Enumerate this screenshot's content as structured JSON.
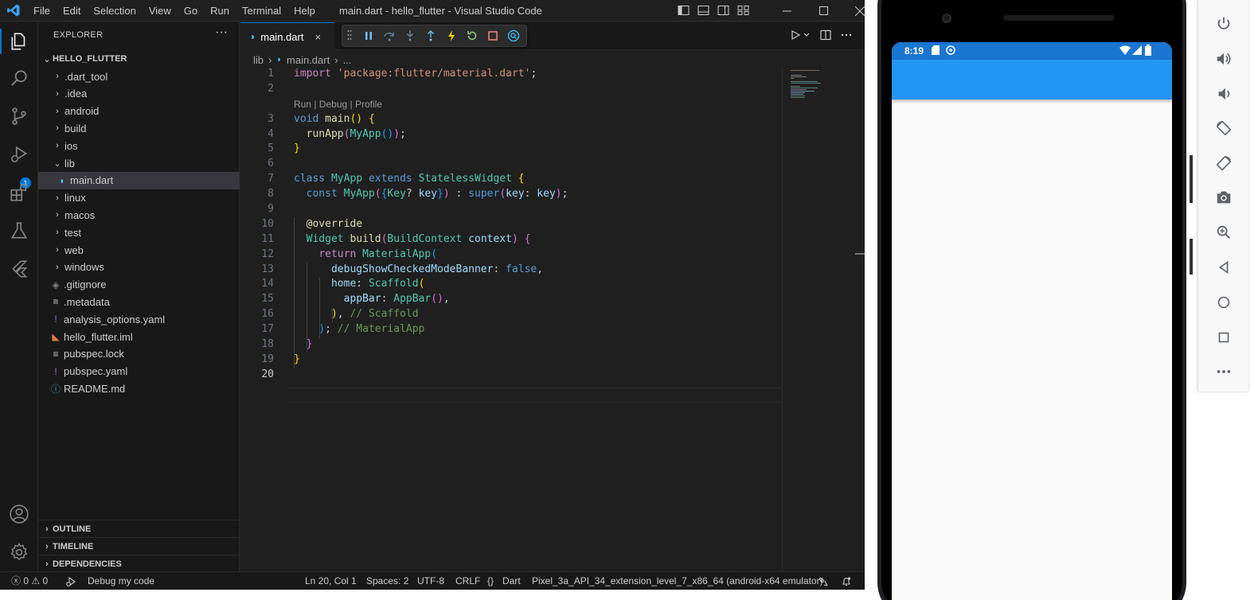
{
  "titlebar": {
    "menu": [
      "File",
      "Edit",
      "Selection",
      "View",
      "Go",
      "Run",
      "Terminal",
      "Help"
    ],
    "title": "main.dart - hello_flutter - Visual Studio Code"
  },
  "activitybar": {
    "debug_badge": "1"
  },
  "sidebar": {
    "header": "EXPLORER",
    "more": "···",
    "project": "HELLO_FLUTTER",
    "items": [
      {
        "label": ".dart_tool",
        "type": "folder"
      },
      {
        "label": ".idea",
        "type": "folder"
      },
      {
        "label": "android",
        "type": "folder"
      },
      {
        "label": "build",
        "type": "folder"
      },
      {
        "label": "ios",
        "type": "folder"
      },
      {
        "label": "lib",
        "type": "folder-open"
      },
      {
        "label": "main.dart",
        "type": "dart-file"
      },
      {
        "label": "linux",
        "type": "folder"
      },
      {
        "label": "macos",
        "type": "folder"
      },
      {
        "label": "test",
        "type": "folder"
      },
      {
        "label": "web",
        "type": "folder"
      },
      {
        "label": "windows",
        "type": "folder"
      },
      {
        "label": ".gitignore",
        "type": "git-file"
      },
      {
        "label": ".metadata",
        "type": "lines-file"
      },
      {
        "label": "analysis_options.yaml",
        "type": "yaml-file"
      },
      {
        "label": "hello_flutter.iml",
        "type": "rss-file"
      },
      {
        "label": "pubspec.lock",
        "type": "lines-file"
      },
      {
        "label": "pubspec.yaml",
        "type": "yaml-file"
      },
      {
        "label": "README.md",
        "type": "info-file"
      }
    ],
    "sections": [
      "OUTLINE",
      "TIMELINE",
      "DEPENDENCIES"
    ]
  },
  "editor": {
    "tab_label": "main.dart",
    "tab_close": "×",
    "breadcrumb": {
      "folder": "lib",
      "file": "main.dart",
      "more": "..."
    },
    "codelens": "Run | Debug | Profile",
    "line_numbers": [
      "1",
      "2",
      "3",
      "4",
      "5",
      "6",
      "7",
      "8",
      "9",
      "10",
      "11",
      "12",
      "13",
      "14",
      "15",
      "16",
      "17",
      "18",
      "19",
      "20"
    ],
    "code": {
      "l1_kw": "import",
      "l1_str": "'package:flutter/material.dart'",
      "l1_end": ";",
      "l3_kw": "void",
      "l3_fn": "main",
      "l4_fn": "runApp",
      "l4_cls": "MyApp",
      "l7_kw": "class",
      "l7_cls": "MyApp",
      "l7_ext": "extends",
      "l7_cls2": "StatelessWidget",
      "l8_kw": "const",
      "l8_cls": "MyApp",
      "l8_type": "Key",
      "l8_param": "key",
      "l8_super": "super",
      "l8_key": "key",
      "l8_val": "key",
      "l10_ann": "@override",
      "l11_cls": "Widget",
      "l11_fn": "build",
      "l11_type": "BuildContext",
      "l11_param": "context",
      "l12_kw": "return",
      "l12_cls": "MaterialApp",
      "l13_prop": "debugShowCheckedModeBanner",
      "l13_val": "false",
      "l14_prop": "home",
      "l14_cls": "Scaffold",
      "l15_prop": "appBar",
      "l15_cls": "AppBar",
      "l16_cmt": "// Scaffold",
      "l17_cmt": "// MaterialApp"
    }
  },
  "statusbar": {
    "errors": "0",
    "warnings": "0",
    "debug_label": "Debug my code",
    "position": "Ln 20, Col 1",
    "spaces": "Spaces: 2",
    "encoding": "UTF-8",
    "eol": "CRLF",
    "language": "Dart",
    "device": "Pixel_3a_API_34_extension_level_7_x86_64 (android-x64 emulator)"
  },
  "phone": {
    "time": "8:19"
  },
  "colors": {
    "accent": "#0078d4",
    "appbar": "#2196f3",
    "phone_status": "#1976d2"
  }
}
